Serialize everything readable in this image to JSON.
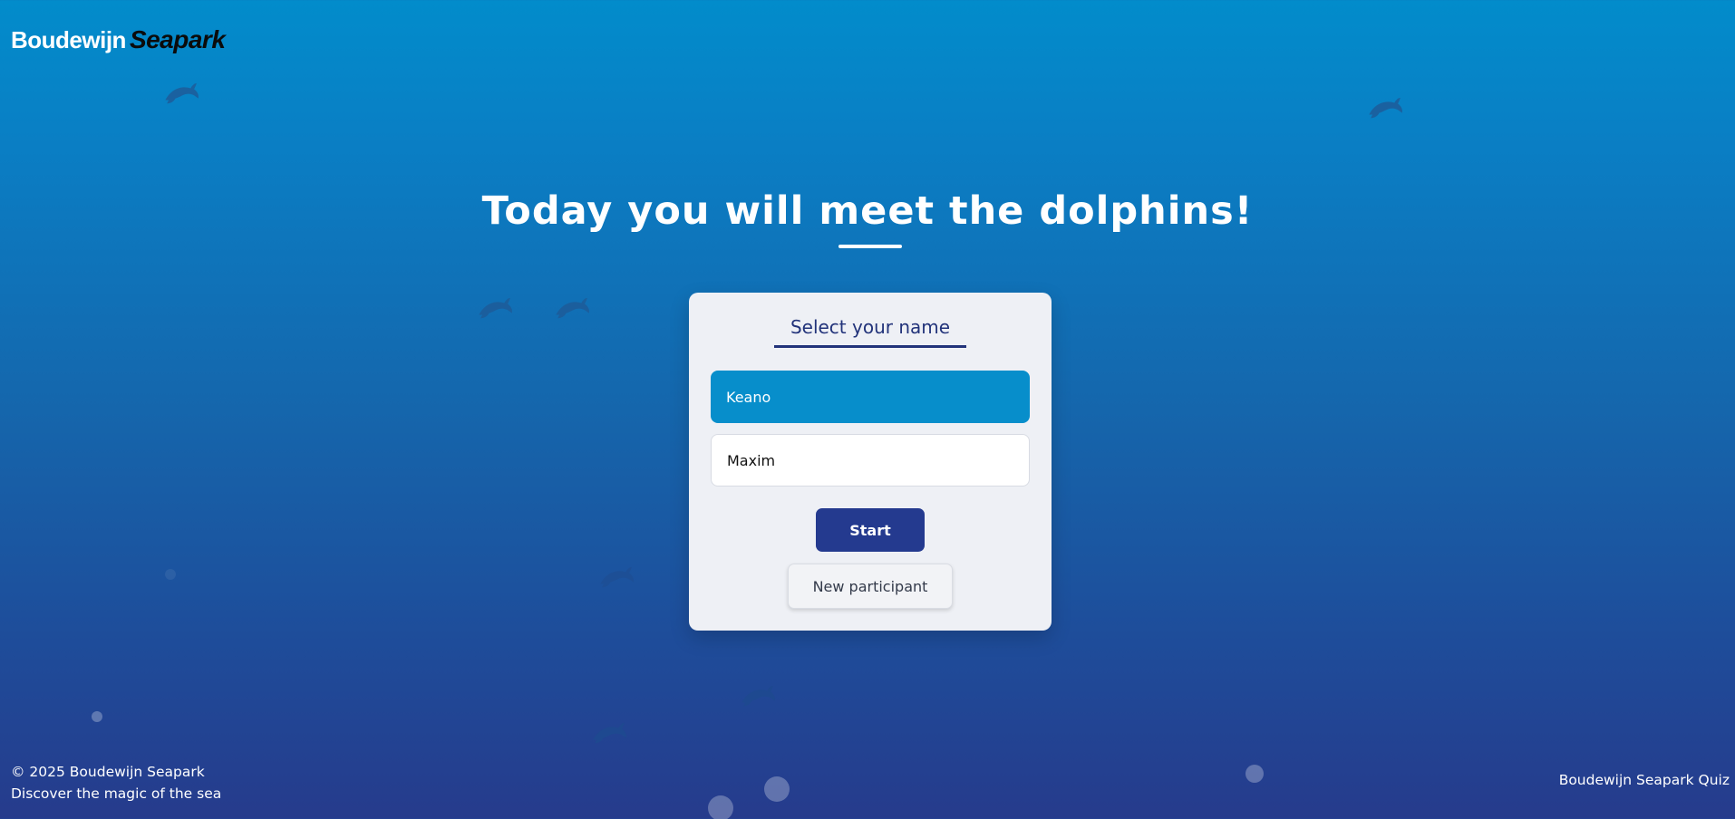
{
  "header": {
    "logo_part1": "Boudewijn",
    "logo_part2": "Seapark"
  },
  "hero": {
    "title": "Today you will meet the dolphins!"
  },
  "card": {
    "title": "Select your name",
    "names": [
      {
        "label": "Keano",
        "selected": true
      },
      {
        "label": "Maxim",
        "selected": false
      }
    ],
    "start_label": "Start",
    "new_participant_label": "New participant"
  },
  "footer": {
    "copyright": "© 2025 Boudewijn Seapark",
    "tagline": "Discover the magic of the sea",
    "app_name": "Boudewijn Seapark Quiz"
  },
  "colors": {
    "accent": "#078ecb",
    "primary": "#243a8f",
    "card_background": "#eef0f5"
  }
}
